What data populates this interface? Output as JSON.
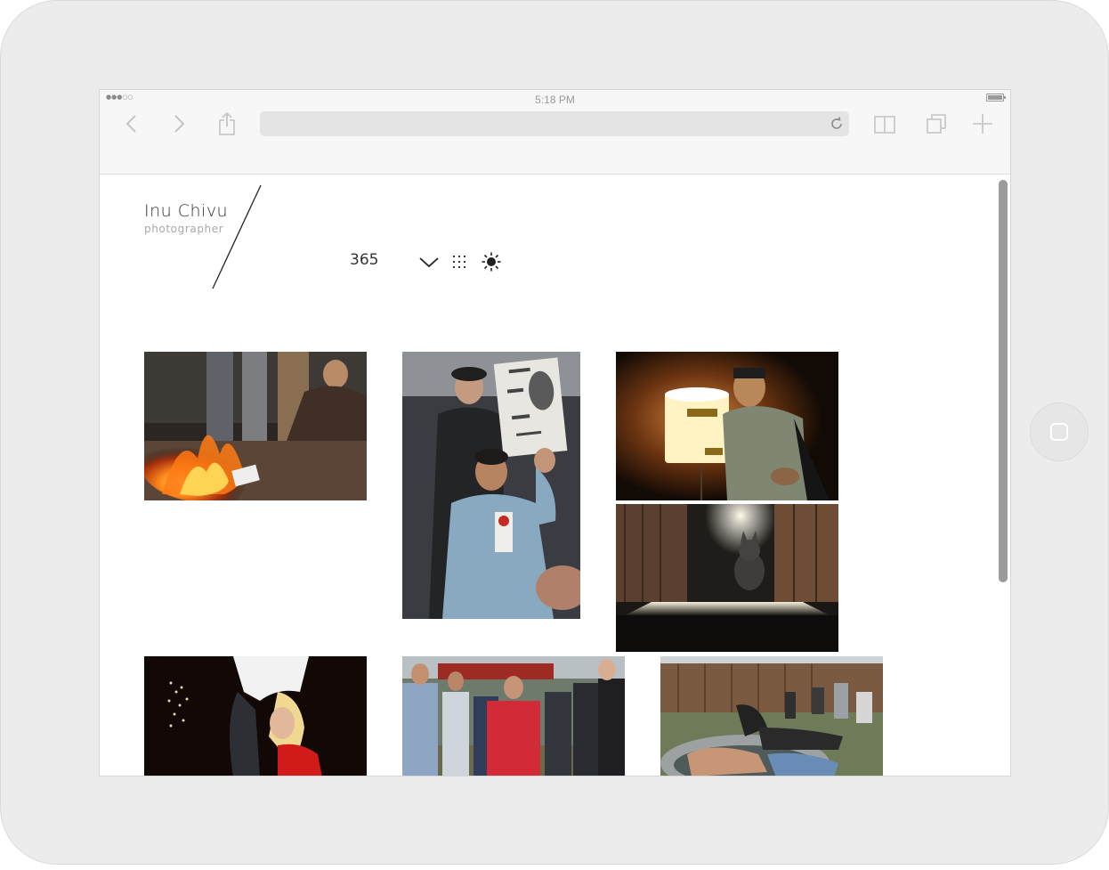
{
  "device": {
    "home_button_icon": "home-square-icon"
  },
  "status_bar": {
    "signal": "●●●○○",
    "time": "5:18 PM",
    "battery_icon": "battery-icon"
  },
  "browser": {
    "back_icon": "chevron-left-icon",
    "forward_icon": "chevron-right-icon",
    "share_icon": "share-icon",
    "url": "",
    "url_placeholder": "",
    "reload_icon": "reload-icon",
    "bookmarks_icon": "book-icon",
    "tabs_icon": "tabs-icon",
    "new_tab_icon": "plus-icon"
  },
  "site": {
    "title": "Inu Chivu",
    "subtitle": "photographer",
    "nav": {
      "item_365": "365",
      "dropdown_icon": "chevron-down-icon",
      "grid_icon": "grid-dots-icon",
      "theme_icon": "sun-icon"
    }
  },
  "gallery": [
    {
      "name": "photo-bonfire",
      "subject": "bonfire"
    },
    {
      "name": "photo-protest-sign",
      "subject": "protest sign"
    },
    {
      "name": "photo-peace-lantern",
      "subject": "peace lantern"
    },
    {
      "name": "photo-kitten-doorway",
      "subject": "kitten in doorway"
    },
    {
      "name": "photo-dancer",
      "subject": "dancer"
    },
    {
      "name": "photo-crowd",
      "subject": "crowd"
    },
    {
      "name": "photo-pool-party",
      "subject": "pool party"
    }
  ],
  "colors": {
    "device": "#ececec",
    "chrome": "#f7f7f7",
    "scrollbar": "#9b9b9b"
  }
}
